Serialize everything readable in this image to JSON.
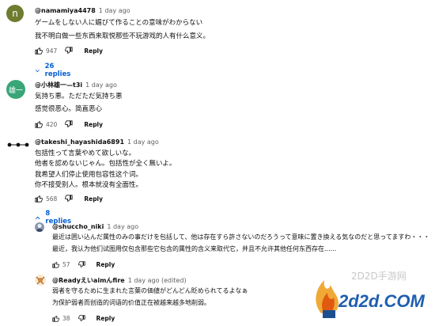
{
  "comments": [
    {
      "handle": "@namamiya4478",
      "time": "1 day ago",
      "avatar_letter": "n",
      "avatar_color": "#6d7c2f",
      "lines": [
        "ゲームをしない人に媚びて作ることの意味がわからない",
        "我不明白做一些东西来取悦那些不玩游戏的人有什么意义。"
      ],
      "likes": "947",
      "reply_label": "Reply",
      "replies_label": "26 replies"
    },
    {
      "handle": "@小林雄一—t3i",
      "time": "1 day ago",
      "avatar_letter": "雄一",
      "avatar_color": "#3aa577",
      "lines": [
        "気持ち悪。ただただ気持ち悪",
        "感觉很恶心。简直恶心"
      ],
      "likes": "420",
      "reply_label": "Reply"
    },
    {
      "handle": "@takeshi_hayashida6891",
      "time": "1 day ago",
      "lines": [
        "包括性って言葉やめて欲しいな。",
        "他者を認めないじゃん。包括性が全く無いよ。",
        "我希望人们停止使用包容性这个词。",
        "你不接受别人。根本就没有全面性。"
      ],
      "likes": "568",
      "reply_label": "Reply",
      "replies_label": "8 replies"
    }
  ],
  "replies": [
    {
      "handle": "@shuccho_niki",
      "time": "1 day ago",
      "lines": [
        "最近は囲い込んだ属性のみの事だけを包括して、他は存在すら許さないのだろうって意味に置き換える気なのだと思ってますわ・・・",
        "最近，我认为他们试图用仅包含那些它包含的属性的含义来取代它，并且不允许其他任何东西存在......"
      ],
      "likes": "57",
      "reply_label": "Reply"
    },
    {
      "handle": "@Readyえいaimんfire",
      "time": "1 day ago (edited)",
      "lines": [
        "弱者を守るために生まれた言葉の価値がどんどん貶められてるよなぁ",
        "为保护弱者而创造的词语的价值正在被越来越多地削弱。"
      ],
      "likes": "38",
      "reply_label": "Reply"
    }
  ],
  "watermark": {
    "top_text": "2D2D手游网",
    "main_text": "2d2d.COM"
  }
}
